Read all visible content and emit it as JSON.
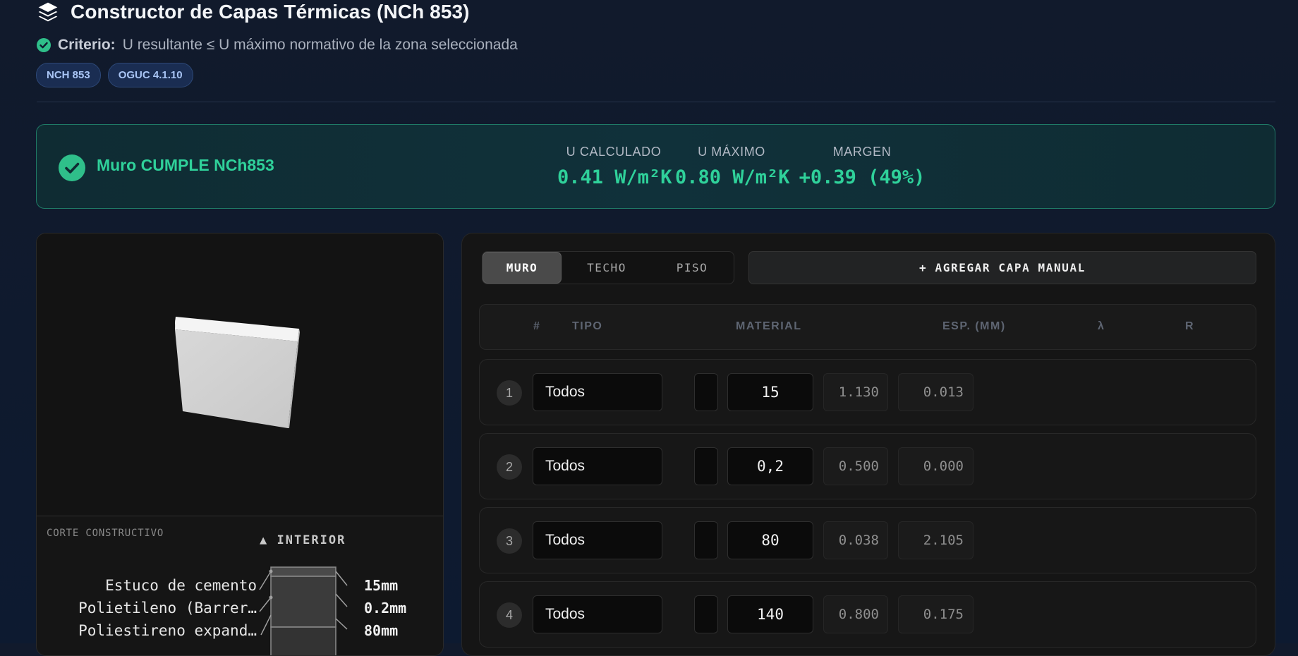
{
  "header": {
    "title": "Constructor de Capas Térmicas (NCh 853)",
    "criterio_label": "Criterio:",
    "criterio_text": "U resultante ≤ U máximo normativo de la zona seleccionada",
    "badges": [
      "NCH 853",
      "OGUC 4.1.10"
    ]
  },
  "status": {
    "message": "Muro CUMPLE NCh853",
    "color": "#2fd19a",
    "metrics": [
      {
        "label": "U CALCULADO",
        "value": "0.41 W/m²K"
      },
      {
        "label": "U MÁXIMO",
        "value": "0.80 W/m²K"
      },
      {
        "label": "MARGEN",
        "value": "+0.39 (49%)"
      }
    ]
  },
  "section": {
    "title": "CORTE CONSTRUCTIVO",
    "interior_label": "▲ INTERIOR",
    "layers": [
      {
        "name": "Estuco de cemento",
        "thickness": "15mm"
      },
      {
        "name": "Polietileno (Barrer…",
        "thickness": "0.2mm"
      },
      {
        "name": "Poliestireno expand…",
        "thickness": "80mm"
      }
    ]
  },
  "tabs": {
    "items": [
      "MURO",
      "TECHO",
      "PISO"
    ],
    "active": "MURO"
  },
  "add_button": "+ AGREGAR CAPA MANUAL",
  "table": {
    "headers": {
      "num": "#",
      "tipo": "TIPO",
      "material": "MATERIAL",
      "esp": "ESP. (MM)",
      "lambda": "λ",
      "r": "R"
    },
    "rows": [
      {
        "num": "1",
        "tipo": "Todos",
        "esp": "15",
        "lambda": "1.130",
        "r": "0.013"
      },
      {
        "num": "2",
        "tipo": "Todos",
        "esp": "0,2",
        "lambda": "0.500",
        "r": "0.000"
      },
      {
        "num": "3",
        "tipo": "Todos",
        "esp": "80",
        "lambda": "0.038",
        "r": "2.105"
      },
      {
        "num": "4",
        "tipo": "Todos",
        "esp": "140",
        "lambda": "0.800",
        "r": "0.175"
      }
    ]
  }
}
